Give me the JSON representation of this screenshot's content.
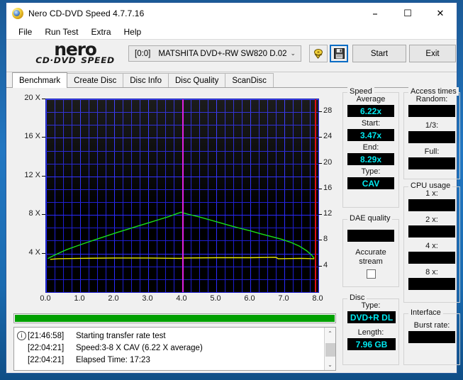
{
  "window": {
    "title": "Nero CD-DVD Speed 4.7.7.16",
    "icon": "nero-disc-icon",
    "minimize": "–",
    "maximize": "☐",
    "close": "✕"
  },
  "menubar": {
    "items": [
      {
        "label": "File"
      },
      {
        "label": "Run Test"
      },
      {
        "label": "Extra"
      },
      {
        "label": "Help"
      }
    ]
  },
  "branding": {
    "word": "nero",
    "sub": "CD·DVD SPEED"
  },
  "toolbar": {
    "drive_index": "[0:0]",
    "drive_name": "MATSHITA DVD+-RW SW820 D.02",
    "chevron": "⌄",
    "eject_icon": "eject-disc-icon",
    "save_icon": "floppy-save-icon",
    "start_label": "Start",
    "exit_label": "Exit"
  },
  "tabs": [
    {
      "label": "Benchmark",
      "active": true
    },
    {
      "label": "Create Disc",
      "active": false
    },
    {
      "label": "Disc Info",
      "active": false
    },
    {
      "label": "Disc Quality",
      "active": false
    },
    {
      "label": "ScanDisc",
      "active": false
    }
  ],
  "chart_data": {
    "type": "line",
    "title": "",
    "xlabel": "",
    "ylabel": "",
    "xtick_labels": [
      "0.0",
      "1.0",
      "2.0",
      "3.0",
      "4.0",
      "5.0",
      "6.0",
      "7.0",
      "8.0"
    ],
    "xtick_values": [
      0,
      1,
      2,
      3,
      4,
      5,
      6,
      7,
      8
    ],
    "xlim": [
      0,
      8
    ],
    "left_axis": {
      "tick_labels": [
        "4 X",
        "8 X",
        "12 X",
        "16 X",
        "20 X"
      ],
      "tick_values": [
        4,
        8,
        12,
        16,
        20
      ],
      "ylim": [
        0,
        20
      ]
    },
    "right_axis": {
      "tick_labels": [
        "4",
        "8",
        "12",
        "16",
        "20",
        "24",
        "28"
      ],
      "tick_values": [
        4,
        8,
        12,
        16,
        20,
        24,
        28
      ],
      "ylim": [
        0,
        30
      ]
    },
    "grid": true,
    "legend": "none",
    "series": [
      {
        "name": "transfer-rate",
        "color": "#18e018",
        "axis": "left",
        "x": [
          0.05,
          0.2,
          0.4,
          0.6,
          0.9,
          1.2,
          1.5,
          1.8,
          2.1,
          2.4,
          2.7,
          3.0,
          3.3,
          3.6,
          3.85,
          3.97,
          4.02,
          4.2,
          4.5,
          4.8,
          5.1,
          5.4,
          5.7,
          6.0,
          6.3,
          6.6,
          6.9,
          7.2,
          7.45,
          7.65,
          7.8,
          7.88
        ],
        "values": [
          3.47,
          3.75,
          4.08,
          4.4,
          4.78,
          5.15,
          5.5,
          5.85,
          6.2,
          6.52,
          6.85,
          7.18,
          7.5,
          7.82,
          8.15,
          8.29,
          8.22,
          8.05,
          7.8,
          7.5,
          7.2,
          6.9,
          6.62,
          6.35,
          6.05,
          5.78,
          5.5,
          5.15,
          4.75,
          4.3,
          3.85,
          3.5
        ]
      },
      {
        "name": "cpu-usage",
        "color": "#e8e800",
        "axis": "right",
        "x": [
          0.12,
          0.35,
          1.0,
          2.0,
          3.0,
          3.95,
          4.05,
          5.0,
          6.0,
          6.75,
          6.82,
          7.5,
          7.88
        ],
        "values": [
          5.1,
          5.2,
          5.25,
          5.3,
          5.3,
          5.25,
          5.3,
          5.35,
          5.35,
          5.4,
          5.2,
          5.25,
          5.2
        ]
      }
    ],
    "markers": [
      {
        "name": "layer-break",
        "x": 4.0,
        "color": "#e020e0"
      },
      {
        "name": "end-of-data",
        "x": 7.9,
        "color": "#e01010"
      }
    ]
  },
  "progress": {
    "percent": 100,
    "color": "#00a000"
  },
  "log": {
    "rows": [
      {
        "icon": "info-icon",
        "time": "[21:46:58]",
        "message": "Starting transfer rate test"
      },
      {
        "icon": "",
        "time": "[22:04:21]",
        "message": "Speed:3-8 X CAV (6.22 X average)"
      },
      {
        "icon": "",
        "time": "[22:04:21]",
        "message": "Elapsed Time: 17:23"
      }
    ],
    "scroll_up": "⌃",
    "scroll_down": "⌄"
  },
  "panels": {
    "speed": {
      "title": "Speed",
      "fields": [
        {
          "label": "Average",
          "value": "6.22x"
        },
        {
          "label": "Start:",
          "value": "3.47x"
        },
        {
          "label": "End:",
          "value": "8.29x"
        },
        {
          "label": "Type:",
          "value": "CAV"
        }
      ]
    },
    "dae_quality": {
      "title": "DAE quality",
      "value": "",
      "checkbox_label_line1": "Accurate",
      "checkbox_label_line2": "stream",
      "checkbox_checked": false
    },
    "disc": {
      "title": "Disc",
      "fields": [
        {
          "label": "Type:",
          "value": "DVD+R DL"
        },
        {
          "label": "Length:",
          "value": "7.96 GB"
        }
      ]
    },
    "access_times": {
      "title": "Access times",
      "fields": [
        {
          "label": "Random:",
          "value": ""
        },
        {
          "label": "1/3:",
          "value": ""
        },
        {
          "label": "Full:",
          "value": ""
        }
      ]
    },
    "cpu_usage": {
      "title": "CPU usage",
      "fields": [
        {
          "label": "1 x:",
          "value": ""
        },
        {
          "label": "2 x:",
          "value": ""
        },
        {
          "label": "4 x:",
          "value": ""
        },
        {
          "label": "8 x:",
          "value": ""
        }
      ]
    },
    "interface": {
      "title": "Interface",
      "fields": [
        {
          "label": "Burst rate:",
          "value": ""
        }
      ]
    }
  },
  "colors": {
    "accent_cyan": "#00e9f0",
    "progress_green": "#00a000",
    "plot_line_green": "#18e018",
    "plot_line_yellow": "#e8e800",
    "grid_blue": "#1e1ed2",
    "layer_break_magenta": "#e020e0",
    "end_marker_red": "#e01010",
    "titlebar_blue": "#1b5a96"
  }
}
